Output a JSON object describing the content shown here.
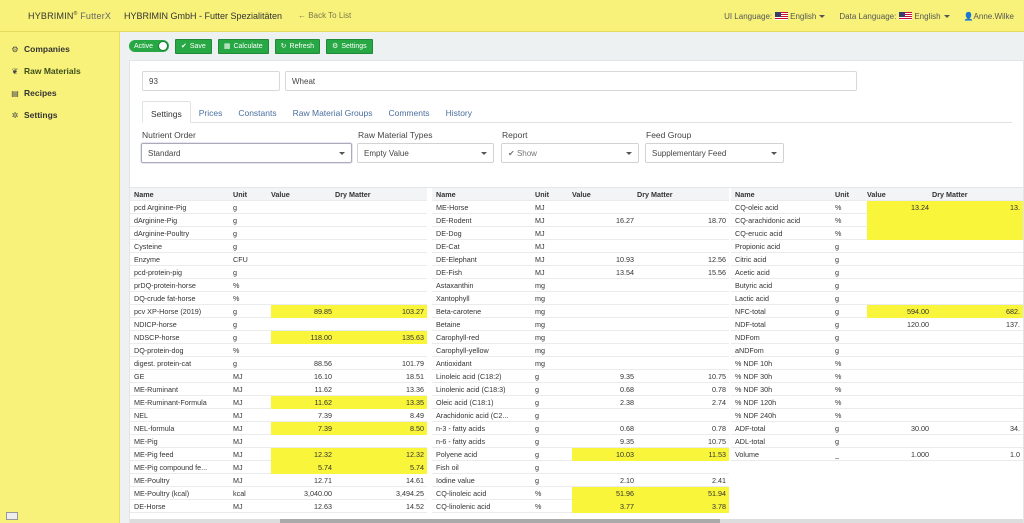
{
  "topbar": {
    "brand": "HYBRIMIN",
    "brand_mark": "®",
    "brand_suffix": "FutterX",
    "company": "HYBRIMIN GmbH - Futter Spezialitäten",
    "back_label": "Back To List",
    "ui_language_label": "UI Language:",
    "ui_language_value": "English",
    "data_language_label": "Data Language:",
    "data_language_value": "English",
    "user": "Anne.Wilke"
  },
  "sidebar": {
    "items": [
      {
        "label": "Companies",
        "icon": "cogs-icon"
      },
      {
        "label": "Raw Materials",
        "icon": "leaf-icon"
      },
      {
        "label": "Recipes",
        "icon": "book-icon"
      },
      {
        "label": "Settings",
        "icon": "gear-icon"
      }
    ]
  },
  "toolbar": {
    "active_label": "Active",
    "save_label": "Save",
    "calculate_label": "Calculate",
    "refresh_label": "Refresh",
    "settings_label": "Settings"
  },
  "material": {
    "id": "93",
    "name": "Wheat"
  },
  "tabs": [
    "Settings",
    "Prices",
    "Constants",
    "Raw Material Groups",
    "Comments",
    "History"
  ],
  "filters": {
    "nutrient_order": {
      "label": "Nutrient Order",
      "value": "Standard"
    },
    "raw_material_types": {
      "label": "Raw Material Types",
      "value": "Empty Value"
    },
    "report": {
      "label": "Report",
      "value": "Show"
    },
    "feed_group": {
      "label": "Feed Group",
      "value": "Supplementary Feed"
    }
  },
  "table": {
    "headers": {
      "name": "Name",
      "unit": "Unit",
      "value": "Value",
      "dry": "Dry Matter"
    },
    "columns": [
      [
        {
          "name": "pcd Arginine-Pig",
          "unit": "g",
          "value": "",
          "dry": ""
        },
        {
          "name": "dArginine-Pig",
          "unit": "g",
          "value": "",
          "dry": ""
        },
        {
          "name": "dArginine-Poultry",
          "unit": "g",
          "value": "",
          "dry": ""
        },
        {
          "name": "Cysteine",
          "unit": "g",
          "value": "",
          "dry": ""
        },
        {
          "name": "Enzyme",
          "unit": "CFU",
          "value": "",
          "dry": ""
        },
        {
          "name": "pcd-protein-pig",
          "unit": "g",
          "value": "",
          "dry": ""
        },
        {
          "name": "prDQ-protein-horse",
          "unit": "%",
          "value": "",
          "dry": ""
        },
        {
          "name": "DQ-crude fat-horse",
          "unit": "%",
          "value": "",
          "dry": ""
        },
        {
          "name": "pcv XP-Horse (2019)",
          "unit": "g",
          "value": "89.85",
          "dry": "103.27",
          "hl": true
        },
        {
          "name": "NDICP-horse",
          "unit": "g",
          "value": "",
          "dry": ""
        },
        {
          "name": "NDSCP-horse",
          "unit": "g",
          "value": "118.00",
          "dry": "135.63",
          "hl": true
        },
        {
          "name": "DQ-protein-dog",
          "unit": "%",
          "value": "",
          "dry": ""
        },
        {
          "name": "digest. protein-cat",
          "unit": "g",
          "value": "88.56",
          "dry": "101.79"
        },
        {
          "name": "GE",
          "unit": "MJ",
          "value": "16.10",
          "dry": "18.51"
        },
        {
          "name": "ME-Ruminant",
          "unit": "MJ",
          "value": "11.62",
          "dry": "13.36"
        },
        {
          "name": "ME-Ruminant-Formula",
          "unit": "MJ",
          "value": "11.62",
          "dry": "13.35",
          "hl": true
        },
        {
          "name": "NEL",
          "unit": "MJ",
          "value": "7.39",
          "dry": "8.49"
        },
        {
          "name": "NEL-formula",
          "unit": "MJ",
          "value": "7.39",
          "dry": "8.50",
          "hl": true
        },
        {
          "name": "ME-Pig",
          "unit": "MJ",
          "value": "",
          "dry": ""
        },
        {
          "name": "ME-Pig feed",
          "unit": "MJ",
          "value": "12.32",
          "dry": "12.32",
          "hl": true
        },
        {
          "name": "ME-Pig compound fe...",
          "unit": "MJ",
          "value": "5.74",
          "dry": "5.74",
          "hl": true
        },
        {
          "name": "ME-Poultry",
          "unit": "MJ",
          "value": "12.71",
          "dry": "14.61"
        },
        {
          "name": "ME-Poultry (kcal)",
          "unit": "kcal",
          "value": "3,040.00",
          "dry": "3,494.25"
        },
        {
          "name": "DE-Horse",
          "unit": "MJ",
          "value": "12.63",
          "dry": "14.52"
        }
      ],
      [
        {
          "name": "ME-Horse",
          "unit": "MJ",
          "value": "",
          "dry": ""
        },
        {
          "name": "DE-Rodent",
          "unit": "MJ",
          "value": "16.27",
          "dry": "18.70"
        },
        {
          "name": "DE-Dog",
          "unit": "MJ",
          "value": "",
          "dry": ""
        },
        {
          "name": "DE-Cat",
          "unit": "MJ",
          "value": "",
          "dry": ""
        },
        {
          "name": "DE-Elephant",
          "unit": "MJ",
          "value": "10.93",
          "dry": "12.56"
        },
        {
          "name": "DE-Fish",
          "unit": "MJ",
          "value": "13.54",
          "dry": "15.56"
        },
        {
          "name": "Astaxanthin",
          "unit": "mg",
          "value": "",
          "dry": ""
        },
        {
          "name": "Xantophyll",
          "unit": "mg",
          "value": "",
          "dry": ""
        },
        {
          "name": "Beta-carotene",
          "unit": "mg",
          "value": "",
          "dry": ""
        },
        {
          "name": "Betaine",
          "unit": "mg",
          "value": "",
          "dry": ""
        },
        {
          "name": "Carophyll-red",
          "unit": "mg",
          "value": "",
          "dry": ""
        },
        {
          "name": "Carophyll-yellow",
          "unit": "mg",
          "value": "",
          "dry": ""
        },
        {
          "name": "Antioxidant",
          "unit": "mg",
          "value": "",
          "dry": ""
        },
        {
          "name": "Linoleic acid (C18:2)",
          "unit": "g",
          "value": "9.35",
          "dry": "10.75"
        },
        {
          "name": "Linolenic acid (C18:3)",
          "unit": "g",
          "value": "0.68",
          "dry": "0.78"
        },
        {
          "name": "Oleic acid (C18:1)",
          "unit": "g",
          "value": "2.38",
          "dry": "2.74"
        },
        {
          "name": "Arachidonic acid (C2...",
          "unit": "g",
          "value": "",
          "dry": ""
        },
        {
          "name": "n-3 - fatty acids",
          "unit": "g",
          "value": "0.68",
          "dry": "0.78"
        },
        {
          "name": "n-6 - fatty acids",
          "unit": "g",
          "value": "9.35",
          "dry": "10.75"
        },
        {
          "name": "Polyene acid",
          "unit": "g",
          "value": "10.03",
          "dry": "11.53",
          "hl": true
        },
        {
          "name": "Fish oil",
          "unit": "g",
          "value": "",
          "dry": ""
        },
        {
          "name": "Iodine value",
          "unit": "g",
          "value": "2.10",
          "dry": "2.41"
        },
        {
          "name": "CQ-linoleic acid",
          "unit": "%",
          "value": "51.96",
          "dry": "51.94",
          "hl": true
        },
        {
          "name": "CQ-linolenic acid",
          "unit": "%",
          "value": "3.77",
          "dry": "3.78",
          "hl": true
        }
      ],
      [
        {
          "name": "CQ-oleic acid",
          "unit": "%",
          "value": "13.24",
          "dry": "13.",
          "hl": true
        },
        {
          "name": "CQ-arachidonic acid",
          "unit": "%",
          "value": "",
          "dry": "",
          "hl": true
        },
        {
          "name": "CQ-erucic acid",
          "unit": "%",
          "value": "",
          "dry": "",
          "hl": true
        },
        {
          "name": "Propionic acid",
          "unit": "g",
          "value": "",
          "dry": ""
        },
        {
          "name": "Citric acid",
          "unit": "g",
          "value": "",
          "dry": ""
        },
        {
          "name": "Acetic acid",
          "unit": "g",
          "value": "",
          "dry": ""
        },
        {
          "name": "Butyric acid",
          "unit": "g",
          "value": "",
          "dry": ""
        },
        {
          "name": "Lactic acid",
          "unit": "g",
          "value": "",
          "dry": ""
        },
        {
          "name": "NFC-total",
          "unit": "g",
          "value": "594.00",
          "dry": "682.",
          "hl": true
        },
        {
          "name": "NDF-total",
          "unit": "g",
          "value": "120.00",
          "dry": "137."
        },
        {
          "name": "NDFom",
          "unit": "g",
          "value": "",
          "dry": ""
        },
        {
          "name": "aNDFom",
          "unit": "g",
          "value": "",
          "dry": ""
        },
        {
          "name": "% NDF 10h",
          "unit": "%",
          "value": "",
          "dry": ""
        },
        {
          "name": "% NDF 30h",
          "unit": "%",
          "value": "",
          "dry": ""
        },
        {
          "name": "% NDF 30h",
          "unit": "%",
          "value": "",
          "dry": ""
        },
        {
          "name": "% NDF 120h",
          "unit": "%",
          "value": "",
          "dry": ""
        },
        {
          "name": "% NDF 240h",
          "unit": "%",
          "value": "",
          "dry": ""
        },
        {
          "name": "ADF-total",
          "unit": "g",
          "value": "30.00",
          "dry": "34."
        },
        {
          "name": "ADL-total",
          "unit": "g",
          "value": "",
          "dry": ""
        },
        {
          "name": "Volume",
          "unit": "_",
          "value": "1.000",
          "dry": "1.0"
        }
      ]
    ]
  },
  "colors": {
    "accent_yellow": "#f8f27a",
    "highlight": "#f9f53a",
    "button_green": "#27a844",
    "link_blue": "#4a6f9e"
  }
}
